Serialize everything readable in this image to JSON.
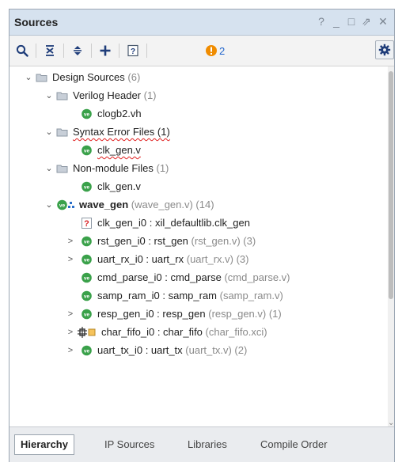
{
  "panel": {
    "title": "Sources",
    "controls": {
      "help": "?",
      "minimize": "_",
      "maximize": "□",
      "float": "⇗",
      "close": "✕"
    }
  },
  "toolbar": {
    "buttons": [
      "search-icon",
      "collapse-all-icon",
      "expand-all-icon",
      "add-icon",
      "hierarchy-update-icon"
    ],
    "warning_count": "2",
    "settings": "gear-icon"
  },
  "tree": {
    "items": [
      {
        "name": "Design Sources",
        "detail": "(6)",
        "chevron": "⌄",
        "icon": "folder-icon"
      },
      {
        "name": "Verilog Header",
        "detail": "(1)",
        "chevron": "⌄",
        "icon": "folder-icon"
      },
      {
        "name": "clogb2.vh",
        "detail": "",
        "chevron": "",
        "icon": "verilog-file-icon"
      },
      {
        "name": "Syntax Error Files (1)",
        "detail": "",
        "chevron": "⌄",
        "icon": "folder-icon",
        "error": true
      },
      {
        "name": "clk_gen.v",
        "detail": "",
        "chevron": "",
        "icon": "verilog-file-icon",
        "error": true
      },
      {
        "name": "Non-module Files",
        "detail": "(1)",
        "chevron": "⌄",
        "icon": "folder-icon"
      },
      {
        "name": "clk_gen.v",
        "detail": "",
        "chevron": "",
        "icon": "verilog-file-icon"
      },
      {
        "name": "wave_gen",
        "detail": "(wave_gen.v) (14)",
        "chevron": "⌄",
        "icon": "top-module-icon",
        "bold": true
      },
      {
        "name": "clk_gen_i0 : xil_defaultlib.clk_gen",
        "detail": "",
        "chevron": "",
        "icon": "missing-module-icon"
      },
      {
        "name": "rst_gen_i0 : rst_gen",
        "detail": "(rst_gen.v) (3)",
        "chevron": ">",
        "icon": "verilog-file-icon"
      },
      {
        "name": "uart_rx_i0 : uart_rx",
        "detail": "(uart_rx.v) (3)",
        "chevron": ">",
        "icon": "verilog-file-icon"
      },
      {
        "name": "cmd_parse_i0 : cmd_parse",
        "detail": "(cmd_parse.v)",
        "chevron": "",
        "icon": "verilog-file-icon"
      },
      {
        "name": "samp_ram_i0 : samp_ram",
        "detail": "(samp_ram.v)",
        "chevron": "",
        "icon": "verilog-file-icon"
      },
      {
        "name": "resp_gen_i0 : resp_gen",
        "detail": "(resp_gen.v) (1)",
        "chevron": ">",
        "icon": "verilog-file-icon"
      },
      {
        "name": "char_fifo_i0 : char_fifo",
        "detail": "(char_fifo.xci)",
        "chevron": ">",
        "icon": "ip-core-icon"
      },
      {
        "name": "uart_tx_i0 : uart_tx",
        "detail": "(uart_tx.v) (2)",
        "chevron": ">",
        "icon": "verilog-file-icon"
      }
    ]
  },
  "tabs": [
    "Hierarchy",
    "IP Sources",
    "Libraries",
    "Compile Order"
  ],
  "colors": {
    "title_bar": "#d6e2ef",
    "verilog_icon": "#3aa14a",
    "warning": "#f08c00",
    "error_underline": "#e02020",
    "count_text": "#2266cc"
  }
}
